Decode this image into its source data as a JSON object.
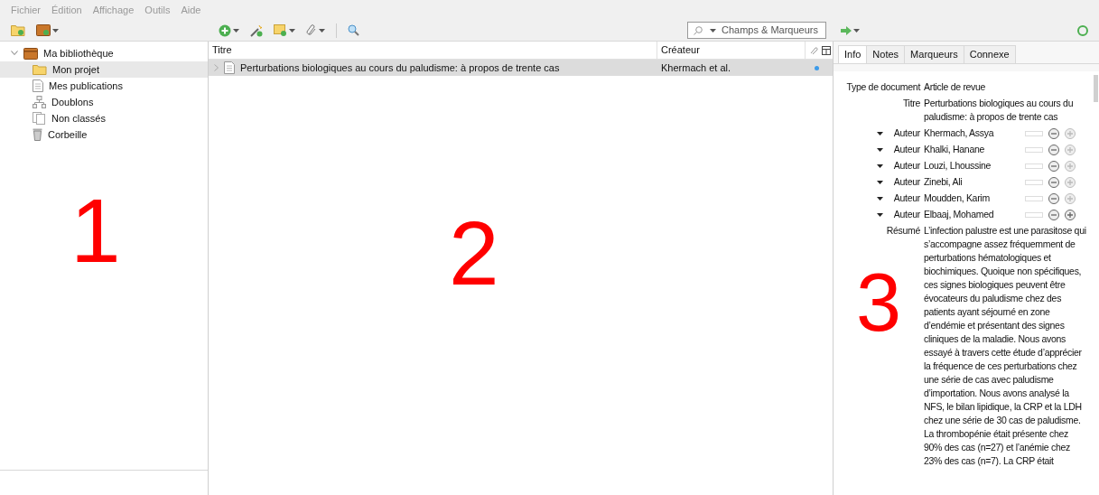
{
  "menu": [
    "Fichier",
    "Édition",
    "Affichage",
    "Outils",
    "Aide"
  ],
  "search": {
    "placeholder": "Champs & Marqueurs"
  },
  "library": {
    "label": "Ma bibliothèque",
    "kind": "library",
    "expanded": true,
    "children": [
      {
        "label": "Mon projet",
        "kind": "folder",
        "selected": true
      },
      {
        "label": "Mes publications",
        "kind": "publications",
        "selected": false
      },
      {
        "label": "Doublons",
        "kind": "duplicates",
        "selected": false
      },
      {
        "label": "Non classés",
        "kind": "unfiled",
        "selected": false
      },
      {
        "label": "Corbeille",
        "kind": "trash",
        "selected": false
      }
    ]
  },
  "table": {
    "columns": [
      "Titre",
      "Créateur"
    ],
    "rows": [
      {
        "title": "Perturbations biologiques au cours du paludisme: à propos de trente cas",
        "creator": "Khermach et al.",
        "selected": true,
        "attachment": true
      }
    ]
  },
  "tabs": [
    {
      "label": "Info",
      "selected": true
    },
    {
      "label": "Notes",
      "selected": false
    },
    {
      "label": "Marqueurs",
      "selected": false
    },
    {
      "label": "Connexe",
      "selected": false
    }
  ],
  "fields": [
    {
      "kind": "text",
      "label": "Type de document",
      "value": "Article de revue"
    },
    {
      "kind": "text",
      "label": "Titre",
      "value": "Perturbations biologiques au cours du paludisme: à propos de trente cas"
    },
    {
      "kind": "creator",
      "label": "Auteur",
      "value": "Khermach, Assya"
    },
    {
      "kind": "creator",
      "label": "Auteur",
      "value": "Khalki, Hanane"
    },
    {
      "kind": "creator",
      "label": "Auteur",
      "value": "Louzi, Lhoussine"
    },
    {
      "kind": "creator",
      "label": "Auteur",
      "value": "Zinebi, Ali"
    },
    {
      "kind": "creator",
      "label": "Auteur",
      "value": "Moudden, Karim"
    },
    {
      "kind": "creator",
      "label": "Auteur",
      "value": "Elbaaj, Mohamed"
    },
    {
      "kind": "text",
      "label": "Résumé",
      "value": "L’infection palustre est une parasitose qui s’accompagne assez fréquemment de perturbations hématologiques et biochimiques. Quoique non spécifiques, ces signes biologiques peuvent être évocateurs du paludisme chez des patients ayant séjourné en zone d’endémie et présentant des signes cliniques de la maladie. Nous avons essayé à travers cette étude d’apprécier la fréquence de ces perturbations chez une série de cas avec paludisme d’importation. Nous avons analysé la NFS, le bilan lipidique, la CRP et la LDH chez une série de 30 cas de paludisme. La thrombopénie était présente chez 90% des cas (n=27) et l’anémie chez 23% des cas (n=7). La CRP était"
    }
  ],
  "annotations": [
    "1",
    "2",
    "3"
  ]
}
